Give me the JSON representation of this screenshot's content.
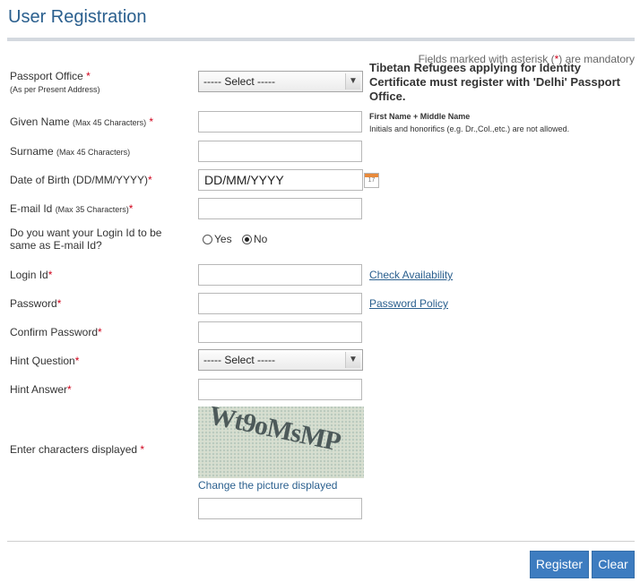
{
  "header": {
    "title": "User Registration"
  },
  "mandatory_note": {
    "prefix": "Fields marked with asterisk (",
    "asterisk": "*",
    "suffix": ") are mandatory"
  },
  "form": {
    "passport_office": {
      "label": "Passport Office",
      "req": "*",
      "sub": "(As per Present Address)",
      "value": "----- Select -----"
    },
    "tibetan_note": "Tibetan Refugees applying for Identity Certificate must register with 'Delhi' Passport Office.",
    "given_name": {
      "label": "Given Name",
      "hint": "(Max 45 Characters)",
      "req": "*"
    },
    "name_note": {
      "title": "First Name + Middle Name",
      "text": "Initials and honorifics (e.g. Dr.,Col.,etc.) are not allowed."
    },
    "surname": {
      "label": "Surname",
      "hint": "(Max 45 Characters)"
    },
    "dob": {
      "label": "Date of Birth (DD/MM/YYYY)",
      "req": "*",
      "value": "DD/MM/YYYY",
      "calendar_day": "17"
    },
    "email": {
      "label": "E-mail Id",
      "hint": "(Max 35 Characters)",
      "req": "*"
    },
    "login_same": {
      "label_line1": "Do you want your Login Id to be",
      "label_line2": "same as E-mail Id?",
      "yes": "Yes",
      "no": "No",
      "selected": "No"
    },
    "login_id": {
      "label": "Login Id",
      "req": "*",
      "link": "Check Availability"
    },
    "password": {
      "label": "Password",
      "req": "*",
      "link": "Password Policy"
    },
    "confirm_password": {
      "label": "Confirm Password",
      "req": "*"
    },
    "hint_question": {
      "label": "Hint Question",
      "req": "*",
      "value": "----- Select -----"
    },
    "hint_answer": {
      "label": "Hint Answer",
      "req": "*"
    },
    "captcha": {
      "label": "Enter characters displayed",
      "req": "*",
      "code": "Wt9oMsMP",
      "change": "Change the picture displayed"
    }
  },
  "buttons": {
    "register": "Register",
    "clear": "Clear"
  }
}
